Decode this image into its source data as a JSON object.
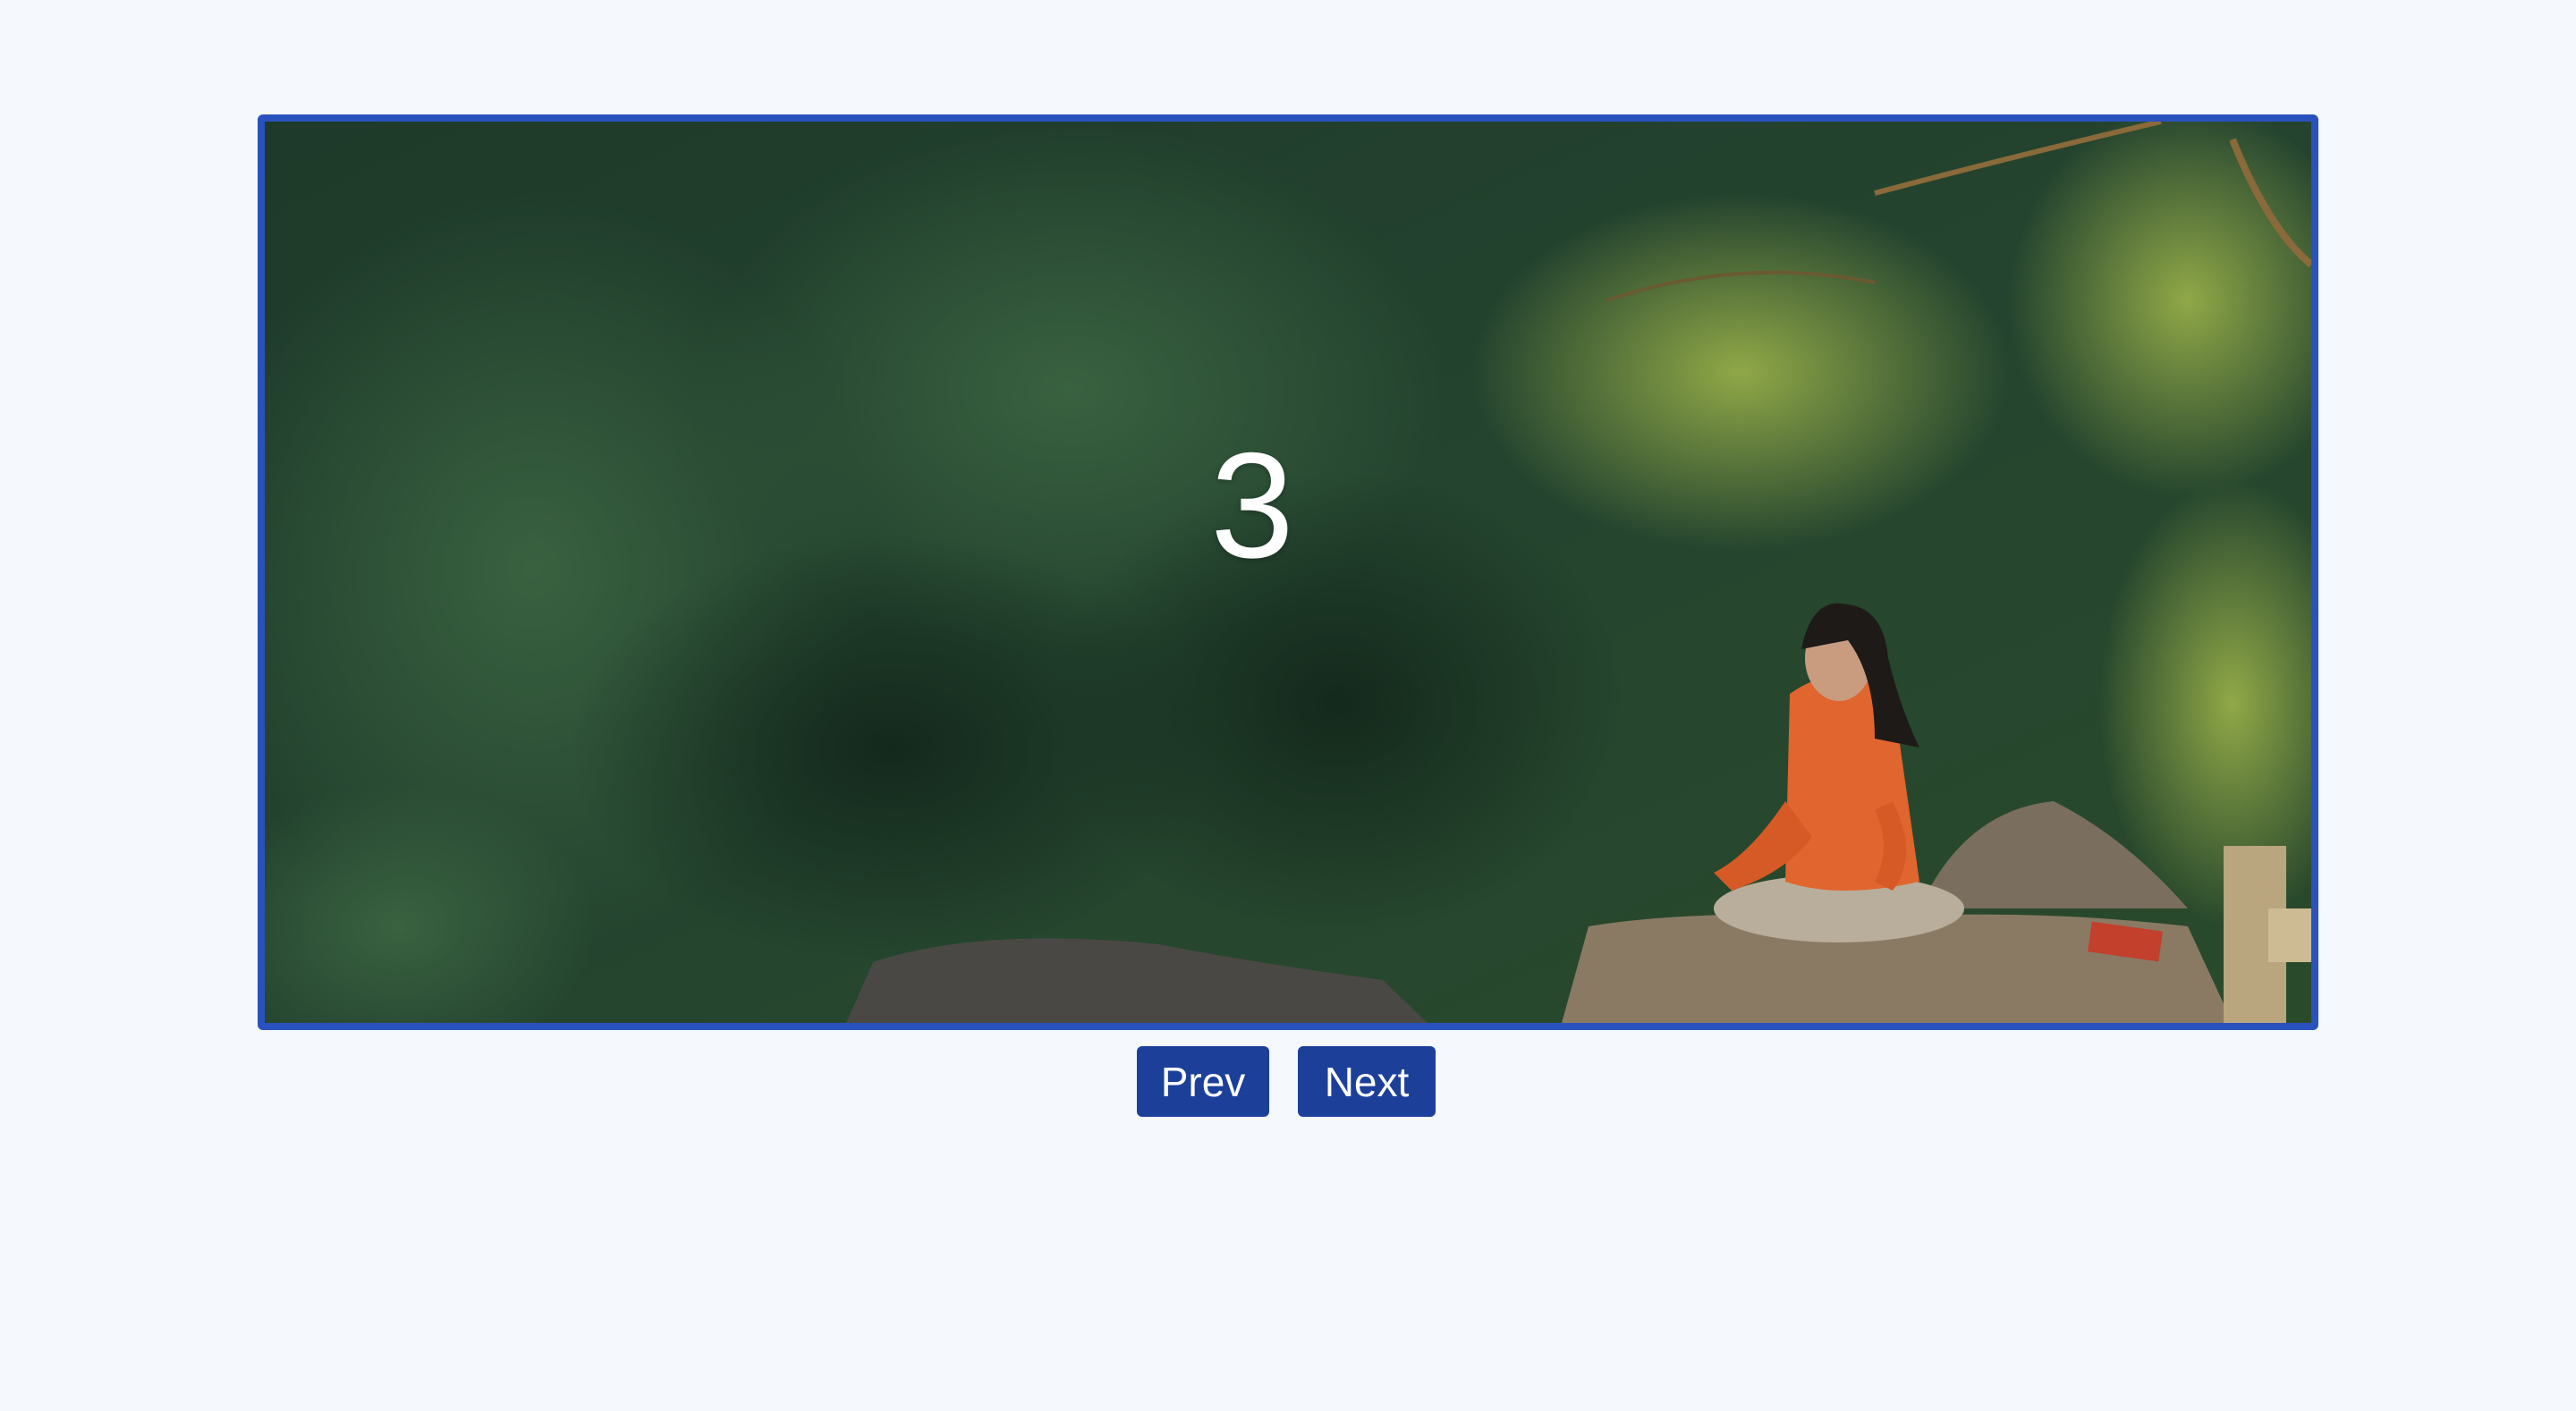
{
  "carousel": {
    "current_slide_label": "3",
    "border_color": "#2a52be",
    "image_description_icon": "meditation-forest-photo"
  },
  "controls": {
    "prev_label": "Prev",
    "next_label": "Next",
    "button_color": "#1c3f99"
  },
  "page": {
    "background_color": "#f5f9fd"
  }
}
